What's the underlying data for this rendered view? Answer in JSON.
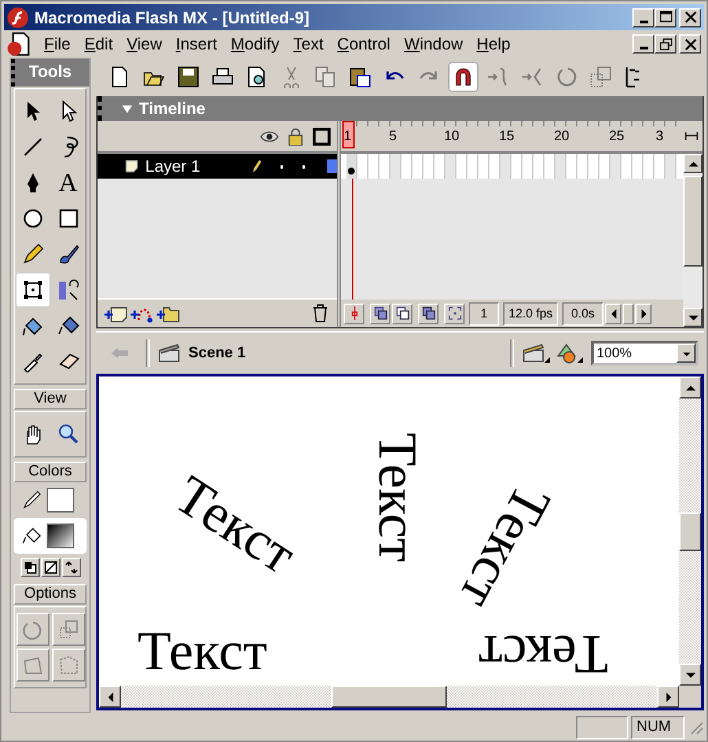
{
  "window": {
    "title": "Macromedia Flash MX - [Untitled-9]"
  },
  "menu": [
    "File",
    "Edit",
    "View",
    "Insert",
    "Modify",
    "Text",
    "Control",
    "Window",
    "Help"
  ],
  "toolbar": [
    {
      "disabled": false,
      "on": false
    },
    {
      "disabled": false,
      "on": false
    },
    {
      "disabled": false,
      "on": false
    },
    {
      "disabled": false,
      "on": false
    },
    {
      "disabled": false,
      "on": false
    },
    {
      "disabled": true,
      "on": false
    },
    {
      "disabled": true,
      "on": false
    },
    {
      "disabled": false,
      "on": false
    },
    {
      "disabled": false,
      "on": false
    },
    {
      "disabled": true,
      "on": false
    },
    {
      "disabled": false,
      "on": true
    },
    {
      "disabled": true,
      "on": false
    },
    {
      "disabled": true,
      "on": false
    },
    {
      "disabled": true,
      "on": false
    },
    {
      "disabled": true,
      "on": false
    },
    {
      "disabled": false,
      "on": false
    }
  ],
  "tools_panel": {
    "title": "Tools",
    "tools": [
      {
        "selected": false
      },
      {
        "selected": false
      },
      {
        "selected": false
      },
      {
        "selected": false
      },
      {
        "selected": false
      },
      {
        "selected": false
      },
      {
        "selected": false
      },
      {
        "selected": false
      },
      {
        "selected": false
      },
      {
        "selected": false
      },
      {
        "selected": true
      },
      {
        "selected": false
      },
      {
        "selected": false
      },
      {
        "selected": false
      },
      {
        "selected": false
      },
      {
        "selected": false
      }
    ],
    "text_tool_label": "A",
    "view_title": "View",
    "colors_title": "Colors",
    "options_title": "Options",
    "fill_selected": true
  },
  "timeline": {
    "title": "Timeline",
    "expanded": true,
    "layers": [
      {
        "name": "Layer 1",
        "selected": true,
        "color": "#5078f0"
      }
    ],
    "frame_numbers": [
      "1",
      "5",
      "10",
      "15",
      "20",
      "25",
      "3"
    ],
    "current_frame": "1",
    "fps": "12.0 fps",
    "time": "0.0s"
  },
  "edit_bar": {
    "scene": "Scene 1",
    "zoom": "100%"
  },
  "stage": {
    "texts": [
      "Текст",
      "Текст",
      "Текст",
      "Текст",
      "Текст"
    ]
  },
  "status_bar": {
    "num": "NUM"
  }
}
